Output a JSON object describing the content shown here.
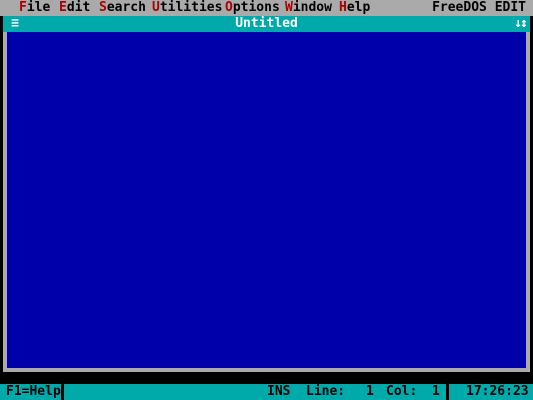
{
  "menu": {
    "items": [
      {
        "hotkey": "F",
        "rest": "ile"
      },
      {
        "hotkey": "E",
        "rest": "dit"
      },
      {
        "hotkey": "S",
        "rest": "earch"
      },
      {
        "hotkey": "U",
        "rest": "tilities"
      },
      {
        "hotkey": "O",
        "rest": "ptions"
      },
      {
        "hotkey": "W",
        "rest": "indow"
      },
      {
        "hotkey": "H",
        "rest": "elp"
      }
    ],
    "app_title": "FreeDOS EDIT"
  },
  "window": {
    "sys_menu_glyph": "≡",
    "title": "Untitled",
    "size_glyph": "↓↕",
    "content": ""
  },
  "status": {
    "help": "F1=Help",
    "mode": "INS",
    "line_label": "Line:",
    "line_value": "1",
    "col_label": "Col:",
    "col_value": "1",
    "time": "17:26:23"
  },
  "colors": {
    "menu_bg": "#aaaaaa",
    "hotkey": "#aa0000",
    "titlebar_bg": "#00aaaa",
    "editor_bg": "#0000aa",
    "statusbar_bg": "#00aaaa"
  }
}
